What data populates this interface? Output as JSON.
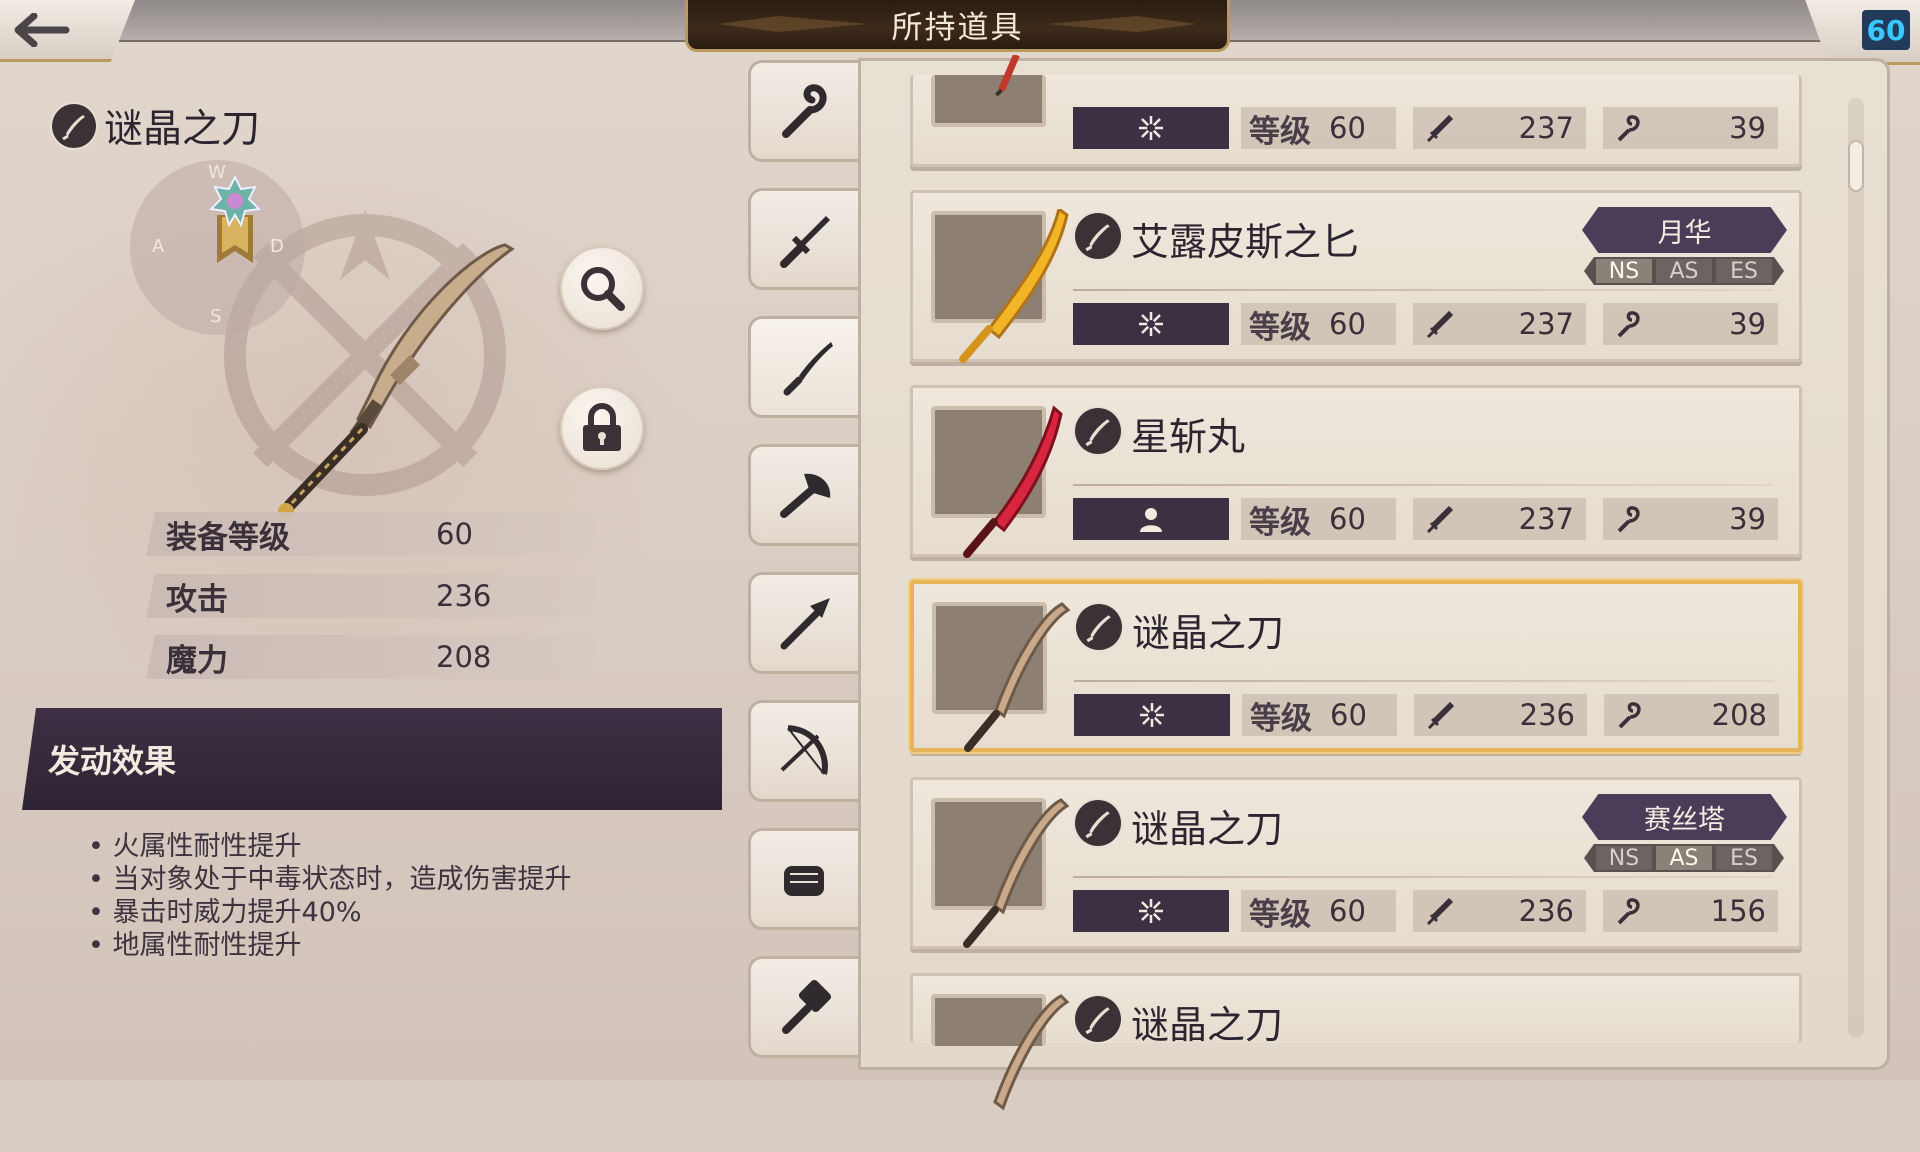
{
  "header": {
    "title": "所持道具",
    "player_level": "60"
  },
  "detail": {
    "name": "谜晶之刀",
    "compass": {
      "n": "W",
      "w": "A",
      "e": "D",
      "s": "S"
    },
    "stats": [
      {
        "label": "装备等级",
        "value": "60"
      },
      {
        "label": "攻击",
        "value": "236"
      },
      {
        "label": "魔力",
        "value": "208"
      }
    ],
    "effect_title": "发动效果",
    "effects": [
      "火属性耐性提升",
      "当对象处于中毒状态时，造成伤害提升",
      "暴击时威力提升40%",
      "地属性耐性提升"
    ],
    "icons": [
      "search-icon",
      "lock-icon"
    ]
  },
  "categories": [
    "staff",
    "sword",
    "katana",
    "axe",
    "spear",
    "bow",
    "fist",
    "hammer"
  ],
  "active_category": "katana",
  "items": [
    {
      "name": "",
      "element": "star",
      "level_label": "等级",
      "level": "60",
      "atk": "237",
      "mag": "39",
      "equipped_by": "",
      "thumb_color": "#c0392b"
    },
    {
      "name": "艾露皮斯之匕",
      "element": "star",
      "level_label": "等级",
      "level": "60",
      "atk": "237",
      "mag": "39",
      "equipped_by": "月华",
      "styles": [
        "NS",
        "AS",
        "ES"
      ],
      "active_style": "NS",
      "thumb_color": "#f1b526"
    },
    {
      "name": "星斩丸",
      "element": "person",
      "level_label": "等级",
      "level": "60",
      "atk": "237",
      "mag": "39",
      "equipped_by": "",
      "thumb_color": "#d7263d"
    },
    {
      "name": "谜晶之刀",
      "element": "star",
      "level_label": "等级",
      "level": "60",
      "atk": "236",
      "mag": "208",
      "equipped_by": "",
      "selected": true,
      "thumb_color": "#c9a98a"
    },
    {
      "name": "谜晶之刀",
      "element": "star",
      "level_label": "等级",
      "level": "60",
      "atk": "236",
      "mag": "156",
      "equipped_by": "赛丝塔",
      "styles": [
        "NS",
        "AS",
        "ES"
      ],
      "active_style": "AS",
      "thumb_color": "#c9a98a"
    },
    {
      "name": "谜晶之刀",
      "element": "star",
      "level_label": "等级",
      "level": "",
      "atk": "",
      "mag": "",
      "equipped_by": "",
      "thumb_color": "#c9a98a"
    }
  ]
}
